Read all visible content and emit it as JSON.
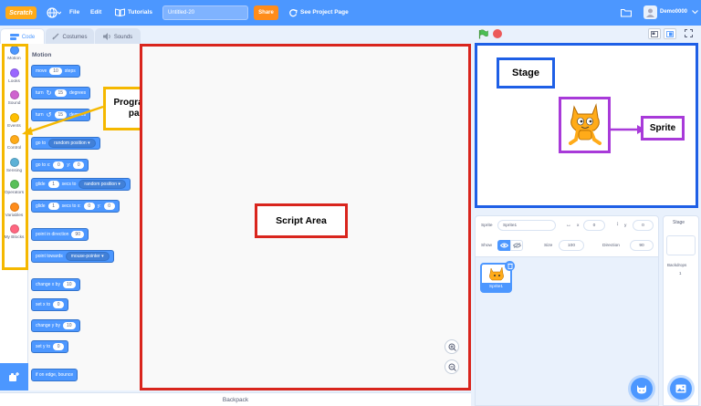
{
  "menubar": {
    "logo": "Scratch",
    "file": "File",
    "edit": "Edit",
    "tutorials": "Tutorials",
    "project_title": "Untitled-20",
    "share": "Share",
    "see_project_page": "See Project Page",
    "username": "Demo0000"
  },
  "tabs": {
    "code": "Code",
    "costumes": "Costumes",
    "sounds": "Sounds"
  },
  "categories": [
    {
      "label": "Motion",
      "color": "#4c97ff"
    },
    {
      "label": "Looks",
      "color": "#9966ff"
    },
    {
      "label": "Sound",
      "color": "#cf63cf"
    },
    {
      "label": "Events",
      "color": "#ffbf00"
    },
    {
      "label": "Control",
      "color": "#ffab19"
    },
    {
      "label": "Sensing",
      "color": "#5cb1d6"
    },
    {
      "label": "Operators",
      "color": "#59c059"
    },
    {
      "label": "Variables",
      "color": "#ff8c1a"
    },
    {
      "label": "My Blocks",
      "color": "#ff6680"
    }
  ],
  "palette": {
    "heading": "Motion",
    "blocks": {
      "move": {
        "a": "move",
        "v": "10",
        "b": "steps"
      },
      "turn_right": {
        "a": "turn",
        "v": "15",
        "b": "degrees"
      },
      "turn_left": {
        "a": "turn",
        "v": "15",
        "b": "degrees"
      },
      "goto": {
        "a": "go to",
        "dd": "random position"
      },
      "gotoxy": {
        "a": "go to x:",
        "x": "0",
        "b": "y:",
        "y": "0"
      },
      "glide1": {
        "a": "glide",
        "v": "1",
        "b": "secs to",
        "dd": "random position"
      },
      "glide2": {
        "a": "glide",
        "v": "1",
        "b": "secs to x:",
        "x": "0",
        "c": "y:",
        "y": "0"
      },
      "point_dir": {
        "a": "point in direction",
        "v": "90"
      },
      "point_towards": {
        "a": "point towards",
        "dd": "mouse-pointer"
      },
      "change_x": {
        "a": "change x by",
        "v": "10"
      },
      "set_x": {
        "a": "set x to",
        "v": "0"
      },
      "change_y": {
        "a": "change y by",
        "v": "10"
      },
      "set_y": {
        "a": "set y to",
        "v": "0"
      },
      "bounce": {
        "a": "if on edge, bounce"
      }
    }
  },
  "annotations": {
    "palette": "Programming palette",
    "script": "Script Area",
    "stage": "Stage",
    "sprite": "Sprite"
  },
  "backpack": "Backpack",
  "sprite_info": {
    "sprite_label": "Sprite",
    "sprite_name": "Sprite1",
    "x_label": "x",
    "x": "0",
    "y_label": "y",
    "y": "0",
    "show_label": "Show",
    "size_label": "Size",
    "size": "100",
    "direction_label": "Direction",
    "direction": "90"
  },
  "sprite_list": {
    "item": "Sprite1"
  },
  "stage_pane": {
    "title": "Stage",
    "backdrops_label": "Backdrops",
    "backdrops_count": "1"
  },
  "colors": {
    "accent": "#4c97ff",
    "share": "#ff8c1a",
    "annotation_red": "#d9251d",
    "annotation_yellow": "#f5b800",
    "annotation_blue": "#1e5fe6",
    "annotation_purple": "#a83ad9"
  }
}
